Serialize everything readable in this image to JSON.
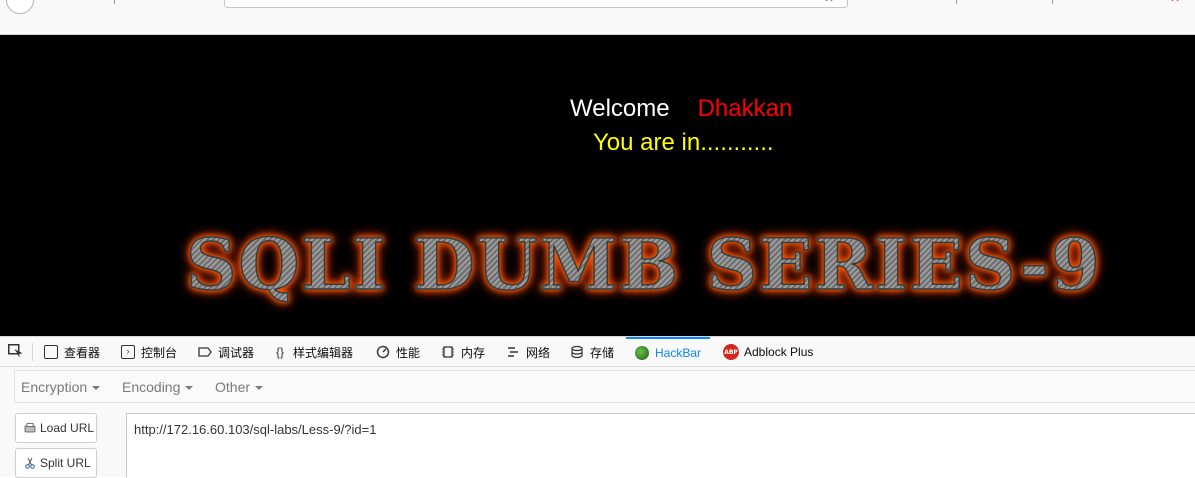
{
  "page": {
    "welcome_label": "Welcome",
    "welcome_name": "Dhakkan",
    "status_text": "You are in...........",
    "banner_text": "SQLI DUMB SERIES-9"
  },
  "devtools": {
    "tabs": [
      {
        "label": "查看器",
        "icon": "inspector-icon"
      },
      {
        "label": "控制台",
        "icon": "console-icon"
      },
      {
        "label": "调试器",
        "icon": "debugger-icon"
      },
      {
        "label": "样式编辑器",
        "icon": "style-editor-icon"
      },
      {
        "label": "性能",
        "icon": "performance-icon"
      },
      {
        "label": "内存",
        "icon": "memory-icon"
      },
      {
        "label": "网络",
        "icon": "network-icon"
      },
      {
        "label": "存储",
        "icon": "storage-icon"
      },
      {
        "label": "HackBar",
        "icon": "hackbar-icon",
        "active": true
      },
      {
        "label": "Adblock Plus",
        "icon": "adblock-plus-icon"
      }
    ],
    "abp_badge": "ABP"
  },
  "hackbar": {
    "menu": [
      {
        "label": "Encryption"
      },
      {
        "label": "Encoding"
      },
      {
        "label": "Other"
      }
    ],
    "load_url_label": "Load URL",
    "split_url_label": "Split URL",
    "url_value": "http://172.16.60.103/sql-labs/Less-9/?id=1"
  },
  "colors": {
    "page_bg": "#000000",
    "welcome_name": "#ff0000",
    "status_text": "#ffff00",
    "active_tab": "#0a84ff"
  }
}
